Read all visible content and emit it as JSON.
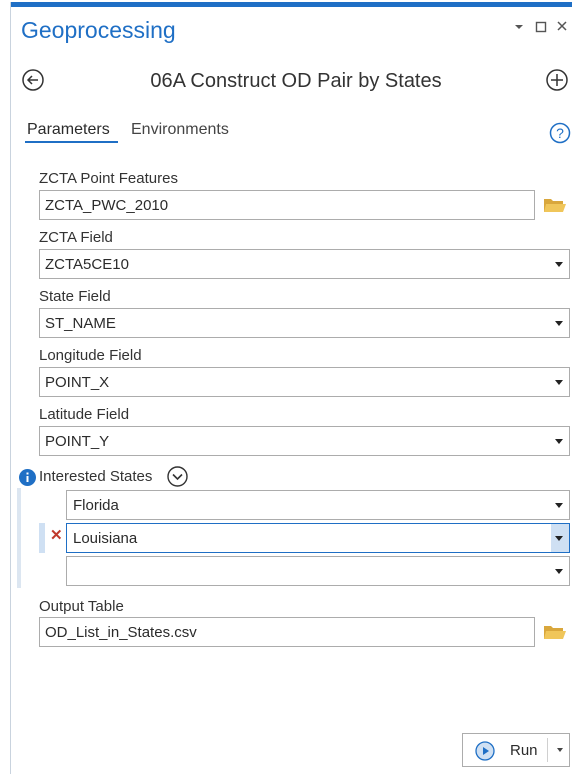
{
  "pane": {
    "title": "Geoprocessing",
    "controls": {
      "menu_icon": "chevron-down-icon",
      "restore_icon": "restore-icon",
      "close_icon": "close-icon"
    }
  },
  "tool": {
    "title": "06A Construct OD Pair by States",
    "back_icon": "back-arrow-icon",
    "add_icon": "plus-circle-icon"
  },
  "tabs": [
    {
      "label": "Parameters",
      "active": true
    },
    {
      "label": "Environments",
      "active": false
    }
  ],
  "help_icon": "help-icon",
  "params": {
    "zcta_point_features": {
      "label": "ZCTA Point Features",
      "value": "ZCTA_PWC_2010"
    },
    "zcta_field": {
      "label": "ZCTA Field",
      "value": "ZCTA5CE10"
    },
    "state_field": {
      "label": "State Field",
      "value": "ST_NAME"
    },
    "longitude_field": {
      "label": "Longitude Field",
      "value": "POINT_X"
    },
    "latitude_field": {
      "label": "Latitude Field",
      "value": "POINT_Y"
    },
    "interested_states": {
      "label": "Interested States",
      "rows": [
        "Florida",
        "Louisiana",
        ""
      ]
    },
    "output_table": {
      "label": "Output Table",
      "value": "OD_List_in_States.csv"
    }
  },
  "run": {
    "label": "Run"
  },
  "colors": {
    "accent": "#1f6fc5",
    "folder": "#e8b84a",
    "remove": "#c0392b",
    "selected_bg": "#cfe0f3"
  }
}
